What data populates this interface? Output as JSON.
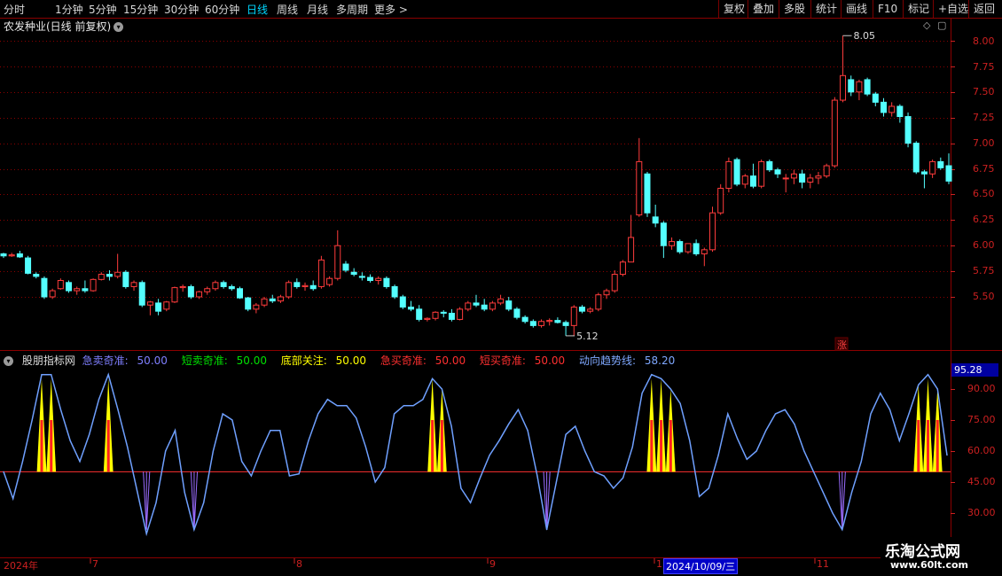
{
  "toolbar": {
    "periods": [
      "分时",
      "1分钟",
      "5分钟",
      "15分钟",
      "30分钟",
      "60分钟",
      "日线",
      "周线",
      "月线",
      "多周期",
      "更多 >"
    ],
    "active_period": "日线",
    "right_buttons": [
      "复权",
      "叠加",
      "多股",
      "统计",
      "画线",
      "F10",
      "标记",
      "+自选",
      "返回"
    ]
  },
  "chart_title": "农发种业(日线 前复权)",
  "price_axis": {
    "ticks": [
      "8.00",
      "7.75",
      "7.50",
      "7.25",
      "7.00",
      "6.75",
      "6.50",
      "6.25",
      "6.00",
      "5.75",
      "5.50"
    ]
  },
  "annotations": {
    "high": "8.05",
    "low": "5.12",
    "zhang": "涨"
  },
  "indicator": {
    "name": "股朋指标网",
    "lines": [
      {
        "label": "急卖奇准:",
        "value": "50.00",
        "color": "#7f7fff"
      },
      {
        "label": "短卖奇准:",
        "value": "50.00",
        "color": "#00e000"
      },
      {
        "label": "底部关注:",
        "value": "50.00",
        "color": "#ffff00"
      },
      {
        "label": "急买奇准:",
        "value": "50.00",
        "color": "#ff3030"
      },
      {
        "label": "短买奇准:",
        "value": "50.00",
        "color": "#ff3030"
      },
      {
        "label": "动向趋势线:",
        "value": "58.20",
        "color": "#7fa8ff"
      }
    ],
    "axis_ticks": [
      "90.00",
      "75.00",
      "60.00",
      "45.00",
      "30.00"
    ],
    "current_value": "95.28"
  },
  "x_axis": {
    "labels": [
      "2024年",
      "7",
      "8",
      "9",
      "1",
      "11"
    ],
    "cursor_date": "2024/10/09/三"
  },
  "watermark": {
    "line1": "乐淘公式网",
    "line2": "www.60lt.com"
  },
  "colors": {
    "up": "#ff3c3c",
    "down": "#54ffff",
    "grid": "#8b0000",
    "trend": "#6fa0ff"
  },
  "chart_data": [
    {
      "type": "candlestick",
      "title": "农发种业(日线 前复权)",
      "ylim": [
        5.1,
        8.1
      ],
      "ohlc": [
        [
          5.92,
          5.93,
          5.88,
          5.9
        ],
        [
          5.9,
          5.93,
          5.89,
          5.91
        ],
        [
          5.92,
          5.95,
          5.88,
          5.89
        ],
        [
          5.88,
          5.9,
          5.72,
          5.73
        ],
        [
          5.72,
          5.74,
          5.68,
          5.7
        ],
        [
          5.68,
          5.7,
          5.48,
          5.5
        ],
        [
          5.5,
          5.58,
          5.48,
          5.56
        ],
        [
          5.58,
          5.68,
          5.57,
          5.66
        ],
        [
          5.64,
          5.66,
          5.54,
          5.56
        ],
        [
          5.56,
          5.6,
          5.52,
          5.58
        ],
        [
          5.58,
          5.66,
          5.54,
          5.56
        ],
        [
          5.56,
          5.68,
          5.55,
          5.67
        ],
        [
          5.67,
          5.74,
          5.66,
          5.72
        ],
        [
          5.72,
          5.76,
          5.66,
          5.7
        ],
        [
          5.7,
          5.92,
          5.68,
          5.74
        ],
        [
          5.74,
          5.76,
          5.58,
          5.6
        ],
        [
          5.6,
          5.66,
          5.56,
          5.64
        ],
        [
          5.64,
          5.66,
          5.4,
          5.42
        ],
        [
          5.42,
          5.46,
          5.32,
          5.45
        ],
        [
          5.44,
          5.48,
          5.32,
          5.36
        ],
        [
          5.38,
          5.46,
          5.36,
          5.45
        ],
        [
          5.45,
          5.6,
          5.44,
          5.59
        ],
        [
          5.59,
          5.62,
          5.55,
          5.6
        ],
        [
          5.6,
          5.62,
          5.48,
          5.5
        ],
        [
          5.5,
          5.56,
          5.48,
          5.55
        ],
        [
          5.55,
          5.6,
          5.52,
          5.58
        ],
        [
          5.58,
          5.66,
          5.56,
          5.64
        ],
        [
          5.64,
          5.66,
          5.58,
          5.6
        ],
        [
          5.6,
          5.62,
          5.56,
          5.58
        ],
        [
          5.58,
          5.6,
          5.48,
          5.49
        ],
        [
          5.49,
          5.5,
          5.36,
          5.38
        ],
        [
          5.38,
          5.44,
          5.34,
          5.42
        ],
        [
          5.42,
          5.5,
          5.4,
          5.48
        ],
        [
          5.48,
          5.52,
          5.44,
          5.46
        ],
        [
          5.46,
          5.52,
          5.44,
          5.5
        ],
        [
          5.5,
          5.66,
          5.48,
          5.64
        ],
        [
          5.64,
          5.68,
          5.58,
          5.6
        ],
        [
          5.6,
          5.64,
          5.56,
          5.61
        ],
        [
          5.61,
          5.66,
          5.56,
          5.58
        ],
        [
          5.6,
          5.9,
          5.58,
          5.86
        ],
        [
          5.62,
          5.7,
          5.6,
          5.68
        ],
        [
          5.68,
          6.15,
          5.66,
          6.0
        ],
        [
          5.82,
          5.85,
          5.74,
          5.76
        ],
        [
          5.74,
          5.78,
          5.7,
          5.72
        ],
        [
          5.7,
          5.74,
          5.66,
          5.69
        ],
        [
          5.69,
          5.72,
          5.64,
          5.66
        ],
        [
          5.66,
          5.7,
          5.62,
          5.68
        ],
        [
          5.68,
          5.7,
          5.58,
          5.6
        ],
        [
          5.6,
          5.62,
          5.48,
          5.5
        ],
        [
          5.5,
          5.52,
          5.38,
          5.4
        ],
        [
          5.4,
          5.46,
          5.36,
          5.38
        ],
        [
          5.38,
          5.42,
          5.26,
          5.28
        ],
        [
          5.28,
          5.3,
          5.26,
          5.29
        ],
        [
          5.29,
          5.36,
          5.27,
          5.35
        ],
        [
          5.35,
          5.37,
          5.3,
          5.34
        ],
        [
          5.34,
          5.38,
          5.26,
          5.28
        ],
        [
          5.28,
          5.4,
          5.27,
          5.38
        ],
        [
          5.38,
          5.46,
          5.36,
          5.44
        ],
        [
          5.44,
          5.52,
          5.4,
          5.42
        ],
        [
          5.42,
          5.48,
          5.36,
          5.38
        ],
        [
          5.38,
          5.46,
          5.36,
          5.44
        ],
        [
          5.44,
          5.52,
          5.42,
          5.48
        ],
        [
          5.46,
          5.5,
          5.36,
          5.38
        ],
        [
          5.38,
          5.4,
          5.28,
          5.3
        ],
        [
          5.3,
          5.32,
          5.24,
          5.26
        ],
        [
          5.26,
          5.28,
          5.2,
          5.22
        ],
        [
          5.22,
          5.28,
          5.2,
          5.26
        ],
        [
          5.26,
          5.29,
          5.22,
          5.27
        ],
        [
          5.27,
          5.3,
          5.24,
          5.25
        ],
        [
          5.25,
          5.27,
          5.12,
          5.22
        ],
        [
          5.22,
          5.42,
          5.12,
          5.4
        ],
        [
          5.4,
          5.42,
          5.34,
          5.36
        ],
        [
          5.36,
          5.4,
          5.34,
          5.38
        ],
        [
          5.38,
          5.54,
          5.36,
          5.52
        ],
        [
          5.52,
          5.58,
          5.48,
          5.56
        ],
        [
          5.56,
          5.76,
          5.54,
          5.72
        ],
        [
          5.72,
          5.86,
          5.7,
          5.84
        ],
        [
          5.84,
          6.3,
          5.96,
          6.08
        ],
        [
          6.3,
          7.05,
          6.28,
          6.82
        ],
        [
          6.7,
          6.72,
          6.28,
          6.32
        ],
        [
          6.28,
          6.4,
          6.18,
          6.22
        ],
        [
          6.22,
          6.24,
          5.88,
          6.0
        ],
        [
          6.0,
          6.08,
          5.96,
          6.04
        ],
        [
          6.04,
          6.06,
          5.92,
          5.94
        ],
        [
          5.94,
          6.02,
          5.92,
          6.02
        ],
        [
          6.02,
          6.06,
          5.9,
          5.92
        ],
        [
          5.92,
          5.98,
          5.8,
          5.96
        ],
        [
          5.96,
          6.38,
          5.94,
          6.32
        ],
        [
          6.32,
          6.6,
          6.3,
          6.56
        ],
        [
          6.56,
          6.86,
          6.52,
          6.82
        ],
        [
          6.84,
          6.86,
          6.58,
          6.6
        ],
        [
          6.6,
          6.7,
          6.56,
          6.68
        ],
        [
          6.68,
          6.8,
          6.56,
          6.58
        ],
        [
          6.58,
          6.84,
          6.56,
          6.82
        ],
        [
          6.82,
          6.84,
          6.72,
          6.74
        ],
        [
          6.74,
          6.76,
          6.66,
          6.7
        ],
        [
          6.66,
          6.7,
          6.52,
          6.66
        ],
        [
          6.66,
          6.74,
          6.6,
          6.7
        ],
        [
          6.7,
          6.74,
          6.56,
          6.62
        ],
        [
          6.62,
          6.7,
          6.56,
          6.66
        ],
        [
          6.66,
          6.72,
          6.6,
          6.68
        ],
        [
          6.68,
          6.8,
          6.66,
          6.78
        ],
        [
          6.78,
          7.45,
          6.76,
          7.42
        ],
        [
          7.42,
          8.05,
          7.4,
          7.66
        ],
        [
          7.62,
          7.66,
          7.46,
          7.5
        ],
        [
          7.5,
          7.62,
          7.42,
          7.6
        ],
        [
          7.62,
          7.64,
          7.46,
          7.48
        ],
        [
          7.48,
          7.5,
          7.36,
          7.4
        ],
        [
          7.4,
          7.44,
          7.26,
          7.3
        ],
        [
          7.3,
          7.4,
          7.26,
          7.36
        ],
        [
          7.36,
          7.38,
          7.2,
          7.26
        ],
        [
          7.26,
          7.3,
          6.96,
          7.0
        ],
        [
          7.0,
          7.02,
          6.7,
          6.72
        ],
        [
          6.72,
          6.74,
          6.56,
          6.7
        ],
        [
          6.7,
          6.84,
          6.66,
          6.82
        ],
        [
          6.82,
          6.86,
          6.74,
          6.76
        ],
        [
          6.78,
          6.9,
          6.6,
          6.63
        ]
      ]
    },
    {
      "type": "line",
      "series": [
        {
          "name": "动向趋势线",
          "values": [
            50,
            37,
            55,
            75,
            97,
            97,
            80,
            65,
            55,
            68,
            85,
            97,
            80,
            62,
            41,
            20,
            35,
            60,
            70,
            40,
            22,
            35,
            60,
            78,
            75,
            55,
            48,
            60,
            70,
            70,
            48,
            49,
            65,
            78,
            85,
            82,
            82,
            76,
            62,
            45,
            52,
            78,
            82,
            82,
            85,
            95,
            90,
            72,
            42,
            35,
            47,
            58,
            65,
            73,
            80,
            70,
            48,
            22,
            45,
            68,
            72,
            60,
            50,
            48,
            42,
            47,
            62,
            88,
            97,
            95,
            90,
            83,
            65,
            38,
            42,
            58,
            78,
            66,
            56,
            60,
            70,
            78,
            80,
            73,
            60,
            50,
            40,
            30,
            22,
            40,
            55,
            78,
            88,
            80,
            65,
            78,
            92,
            97,
            90,
            58
          ]
        }
      ],
      "ylim": [
        15,
        100
      ]
    }
  ]
}
